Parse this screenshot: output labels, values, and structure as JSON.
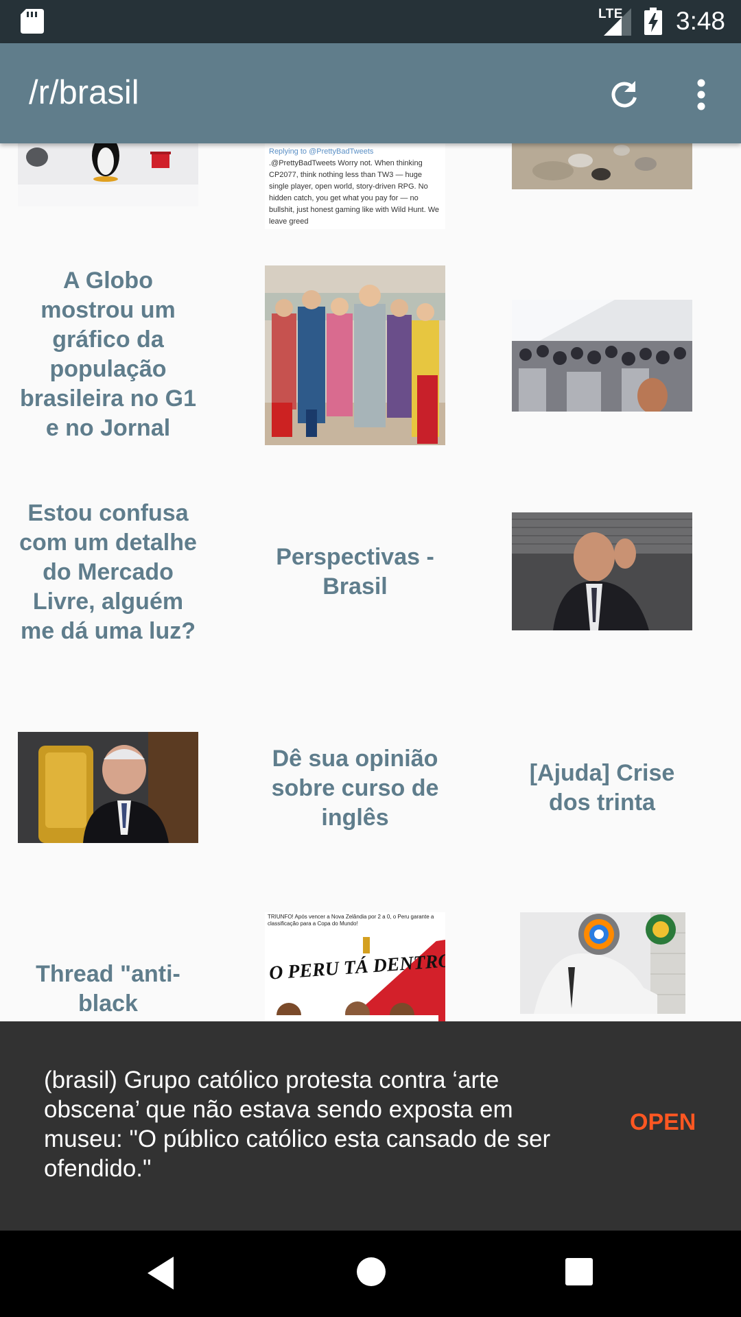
{
  "status_bar": {
    "network": "LTE",
    "time": "3:48"
  },
  "app_bar": {
    "title": "/r/brasil",
    "refresh_icon": "refresh-icon",
    "overflow_icon": "more-vert-icon"
  },
  "posts": [
    {
      "kind": "image",
      "alt": "penguin-thumbnail"
    },
    {
      "kind": "image",
      "alt": "tweet-screenshot-thumbnail"
    },
    {
      "kind": "image",
      "alt": "stones-thumbnail"
    },
    {
      "kind": "text",
      "title": "A Globo mostrou um gráfico da população brasileira no G1 e no Jornal"
    },
    {
      "kind": "image",
      "alt": "propaganda-poster-thumbnail"
    },
    {
      "kind": "image",
      "alt": "crowd-thumbnail"
    },
    {
      "kind": "text",
      "title": "Estou confusa com um detalhe do Mercado Livre, alguém me dá uma luz?"
    },
    {
      "kind": "text",
      "title": "Perspectivas - Brasil"
    },
    {
      "kind": "image",
      "alt": "man-on-phone-thumbnail"
    },
    {
      "kind": "image",
      "alt": "judge-thumbnail"
    },
    {
      "kind": "text",
      "title": "Dê sua opinião sobre curso de inglês"
    },
    {
      "kind": "text",
      "title": "[Ajuda] Crise dos trinta"
    },
    {
      "kind": "text",
      "title": "Thread \"anti-black"
    },
    {
      "kind": "image",
      "alt": "peru-world-cup-thumbnail"
    },
    {
      "kind": "image",
      "alt": "globo-meme-thumbnail"
    }
  ],
  "thumb_text": {
    "tweet_reply": "Replying to @PrettyBadTweets",
    "tweet_body": ".@PrettyBadTweets Worry not. When thinking CP2077, think nothing less than TW3 — huge single player, open world, story-driven RPG. No hidden catch, you get what you pay for — no bullshit, just honest gaming like with Wild Hunt. We leave greed",
    "peru_header": "TRIUNFO! Após vencer a Nova Zelândia por 2 a 0, o Peru garante a classificação para a Copa do Mundo!",
    "peru_slogan": "O PERU TÁ DENTRO!"
  },
  "snackbar": {
    "message": "(brasil) Grupo católico protesta contra ‘arte obscena’ que não estava sendo exposta em museu: \"O público católico esta cansado de ser ofendido.\"",
    "action": "OPEN"
  },
  "nav_bar": {
    "back_icon": "back-icon",
    "home_icon": "home-icon",
    "recents_icon": "recents-icon"
  },
  "colors": {
    "status_bar": "#263238",
    "app_bar": "#607d8b",
    "title_text": "#5f7d8c",
    "snackbar_bg": "#323232",
    "snackbar_action": "#ff5722"
  }
}
